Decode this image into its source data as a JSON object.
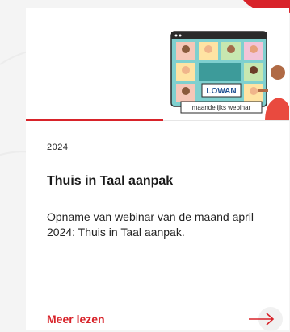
{
  "card": {
    "year": "2024",
    "title": "Thuis in Taal aanpak",
    "description": "Opname van webinar van de maand april 2024: Thuis in Taal aanpak.",
    "read_more_label": "Meer lezen",
    "illustration": {
      "logo_text": "LOWAN",
      "caption": "maandelijks webinar"
    }
  },
  "colors": {
    "accent": "#d8232a",
    "background": "#f4f4f4",
    "card": "#ffffff"
  },
  "icons": {
    "arrow": "arrow-right-icon"
  }
}
